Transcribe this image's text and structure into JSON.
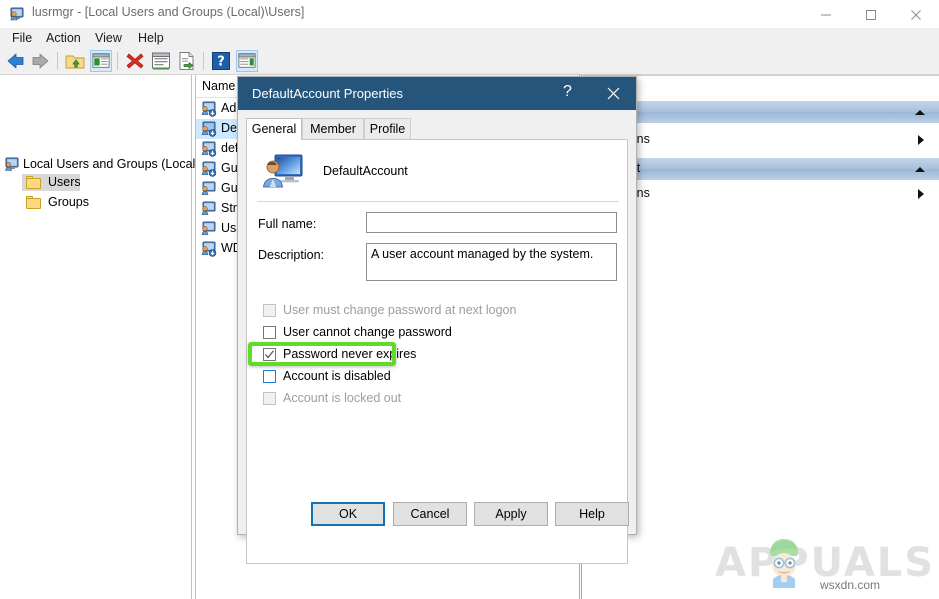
{
  "window": {
    "title": "lusrmgr - [Local Users and Groups (Local)\\Users]",
    "icon": "computer-users-icon",
    "controls": {
      "minimize": "Minimize",
      "maximize": "Maximize",
      "close": "Close"
    }
  },
  "menubar": {
    "items": [
      {
        "label": "File"
      },
      {
        "label": "Action"
      },
      {
        "label": "View"
      },
      {
        "label": "Help"
      }
    ]
  },
  "toolbar": {
    "buttons": [
      {
        "name": "back-icon",
        "title": "Back"
      },
      {
        "name": "forward-icon",
        "title": "Forward"
      },
      {
        "name": "up-folder-icon",
        "title": "Up One Level"
      },
      {
        "name": "show-hide-tree-icon",
        "title": "Show/Hide Console Tree"
      },
      {
        "name": "delete-icon",
        "title": "Delete"
      },
      {
        "name": "properties-icon",
        "title": "Properties"
      },
      {
        "name": "export-list-icon",
        "title": "Export List"
      },
      {
        "name": "help-icon",
        "title": "Help"
      },
      {
        "name": "show-hide-action-pane-icon",
        "title": "Show/Hide Action Pane"
      }
    ]
  },
  "tree": {
    "root": {
      "label": "Local Users and Groups (Local)",
      "icon": "computer-icon"
    },
    "children": [
      {
        "label": "Users",
        "icon": "folder-icon",
        "selected": true
      },
      {
        "label": "Groups",
        "icon": "folder-icon",
        "selected": false
      }
    ]
  },
  "list": {
    "columns": [
      "Name"
    ],
    "rows": [
      {
        "name": "Adm",
        "icon": "user-disabled-icon",
        "selected": false
      },
      {
        "name": "Def",
        "icon": "user-disabled-icon",
        "selected": true
      },
      {
        "name": "def",
        "icon": "user-disabled-icon",
        "selected": false
      },
      {
        "name": "Gue",
        "icon": "user-disabled-icon",
        "selected": false
      },
      {
        "name": "Gue",
        "icon": "user-icon",
        "selected": false
      },
      {
        "name": "Stri",
        "icon": "user-icon",
        "selected": false
      },
      {
        "name": "Usa",
        "icon": "user-icon",
        "selected": false
      },
      {
        "name": "WD",
        "icon": "user-disabled-icon",
        "selected": false
      }
    ]
  },
  "actions_pane": {
    "rows": [
      {
        "type": "header",
        "label": "",
        "caret": "up"
      },
      {
        "type": "item",
        "label": "re Actions",
        "caret": "right"
      },
      {
        "type": "header",
        "label": "Account",
        "caret": "up"
      },
      {
        "type": "item",
        "label": "re Actions",
        "caret": "right"
      }
    ]
  },
  "dialog": {
    "title": "DefaultAccount Properties",
    "help_button": "?",
    "close_button": "×",
    "tabs": [
      {
        "label": "General",
        "active": true
      },
      {
        "label": "Member Of",
        "active": false
      },
      {
        "label": "Profile",
        "active": false
      }
    ],
    "account_icon": "user-monitor-icon",
    "account_name": "DefaultAccount",
    "fields": [
      {
        "label": "Full name:",
        "value": "",
        "placeholder": ""
      },
      {
        "label": "Description:",
        "value": "A user account managed by the system.",
        "placeholder": ""
      }
    ],
    "checkboxes": [
      {
        "label": "User must change password at next logon",
        "checked": false,
        "disabled": true,
        "focused": false
      },
      {
        "label": "User cannot change password",
        "checked": false,
        "disabled": false,
        "focused": false
      },
      {
        "label": "Password never expires",
        "checked": true,
        "disabled": false,
        "focused": false
      },
      {
        "label": "Account is disabled",
        "checked": false,
        "disabled": false,
        "focused": true
      },
      {
        "label": "Account is locked out",
        "checked": false,
        "disabled": true,
        "focused": false
      }
    ],
    "buttons": [
      {
        "label": "OK",
        "default": true
      },
      {
        "label": "Cancel",
        "default": false
      },
      {
        "label": "Apply",
        "default": false
      },
      {
        "label": "Help",
        "default": false
      }
    ]
  },
  "annotation": {
    "highlight_color": "#63d929",
    "highlight_target": "Account is disabled"
  },
  "watermark": {
    "brand": "APPUALS",
    "site": "wsxdn.com"
  },
  "colors": {
    "dialog_titlebar": "#26557c",
    "accent_blue": "#1273ba",
    "selection_blue": "#cde8ff",
    "actions_header": "#a8c0dd"
  }
}
